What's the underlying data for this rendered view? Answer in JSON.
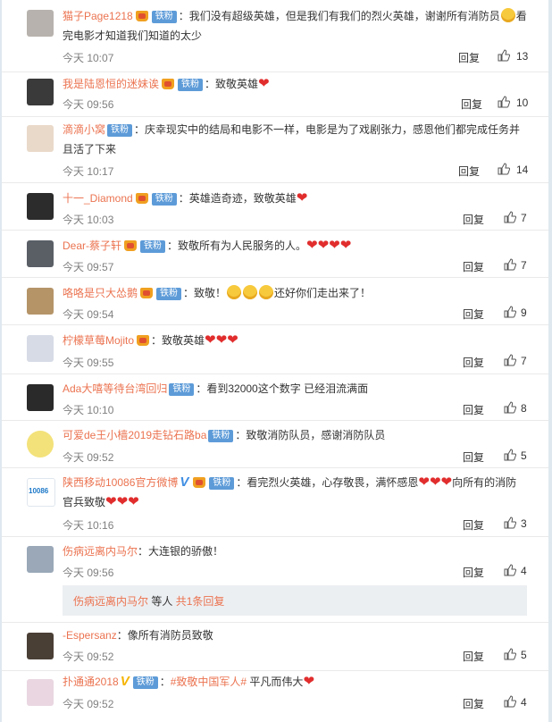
{
  "comments": [
    {
      "user": "猫子Page1218",
      "crown": true,
      "fan": "铁粉",
      "text": "：我们没有超级英雄，但是我们有我们的烈火英雄，谢谢所有消防员",
      "text2": "看完电影才知道我们知道的太少",
      "time": "今天 10:07",
      "reply": "回复",
      "likes": "13"
    },
    {
      "user": "我是陆恩恒的迷妹诶",
      "crown": true,
      "fan": "铁粉",
      "text": "：致敬英雄",
      "time": "今天 09:56",
      "reply": "回复",
      "likes": "10"
    },
    {
      "user": "滴滴小窝",
      "crown": false,
      "fan": "铁粉",
      "text": "：庆幸现实中的结局和电影不一样，电影是为了戏剧张力，感恩他们都完成任务并",
      "text2": "且活了下来",
      "time": "今天 10:17",
      "reply": "回复",
      "likes": "14"
    },
    {
      "user": "十一_Diamond",
      "crown": true,
      "fan": "铁粉",
      "text": "：英雄造奇迹，致敬英雄",
      "time": "今天 10:03",
      "reply": "回复",
      "likes": "7"
    },
    {
      "user": "Dear-蔡子轩",
      "crown": true,
      "fan": "铁粉",
      "text": "：致敬所有为人民服务的人。",
      "time": "今天 09:57",
      "reply": "回复",
      "likes": "7"
    },
    {
      "user": "咯咯是只大怂鹅",
      "crown": true,
      "fan": "铁粉",
      "text": "：致敬！",
      "text_after": "还好你们走出来了！",
      "time": "今天 09:54",
      "reply": "回复",
      "likes": "9"
    },
    {
      "user": "柠檬草莓Mojito",
      "crown": true,
      "fan": "",
      "text": "：致敬英雄",
      "time": "今天 09:55",
      "reply": "回复",
      "likes": "7"
    },
    {
      "user": "Ada大嘻等待台湾回归",
      "crown": false,
      "fan": "铁粉",
      "text": "：看到32000这个数字 已经泪流满面",
      "time": "今天 10:10",
      "reply": "回复",
      "likes": "8"
    },
    {
      "user": "可爱de王小樯2019走钻石路ba",
      "crown": false,
      "fan": "铁粉",
      "text": "：致敬消防队员，感谢消防队员",
      "time": "今天 09:52",
      "reply": "回复",
      "likes": "5"
    },
    {
      "user": "陕西移动10086官方微博",
      "crown": true,
      "fan": "铁粉",
      "vmark": "V",
      "text": "：看完烈火英雄，心存敬畏，满怀感恩",
      "text_after": "向所有的消",
      "text2": "防官兵致敬",
      "avatar_text": "10086",
      "time": "今天 10:16",
      "reply": "回复",
      "likes": "3"
    },
    {
      "user": "伤病远离内马尔",
      "crown": false,
      "fan": "",
      "text": "：大连银的骄傲！",
      "time": "今天 09:56",
      "reply": "回复",
      "likes": "4"
    },
    {
      "user": "-Espersanz",
      "crown": false,
      "fan": "",
      "text": "：像所有消防员致敬",
      "time": "今天 09:52",
      "reply": "回复",
      "likes": "5"
    },
    {
      "user": "扑通通2018",
      "crown": false,
      "fan": "铁粉",
      "vmark": "V",
      "text": "：",
      "hashtag": "#致敬中国军人#",
      "text_after": " 平凡而伟大",
      "time": "今天 09:52",
      "reply": "回复",
      "likes": "4"
    }
  ],
  "subreply": {
    "name": "伤病远离内马尔",
    "middle": " 等人 ",
    "count": "共1条回复"
  },
  "colors": {
    "username": "#eb7350",
    "fan_badge": "#5d9bd8",
    "heart": "#e12d2d"
  }
}
